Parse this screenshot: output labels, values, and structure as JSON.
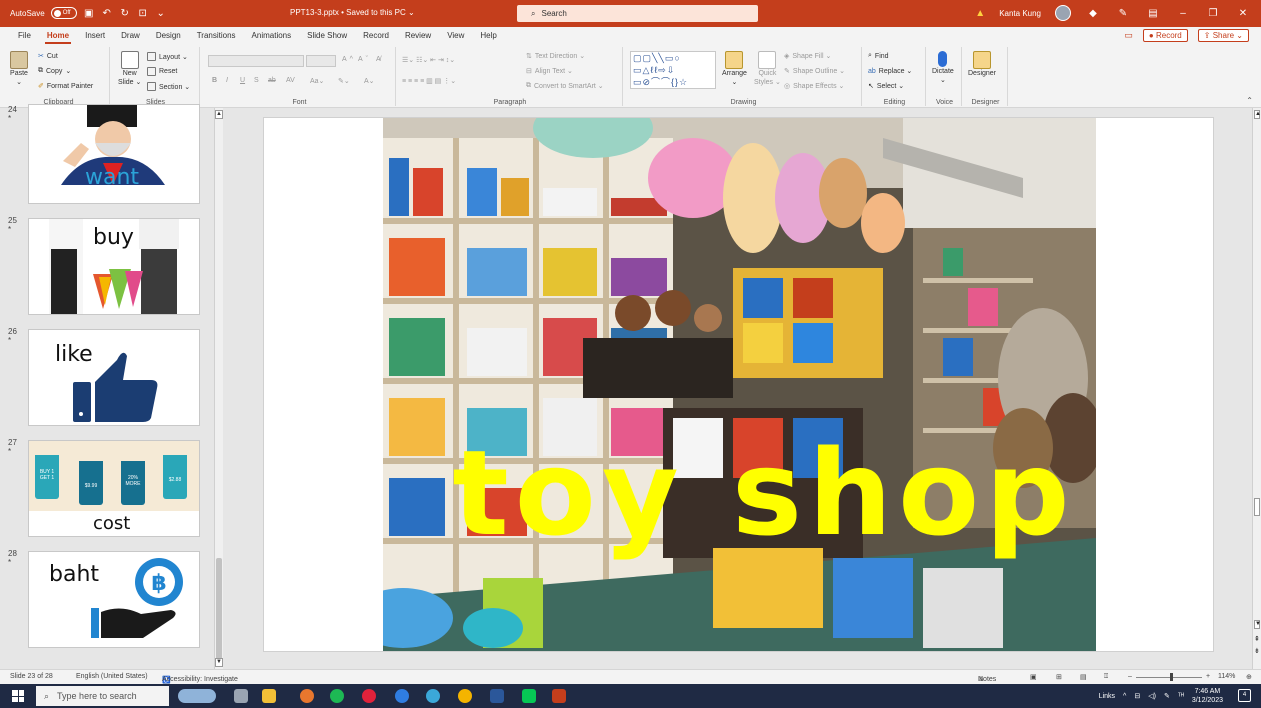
{
  "titlebar": {
    "autosave_label": "AutoSave",
    "autosave_state": "Off",
    "doc_title": "PPT13-3.pptx • Saved to this PC ⌄",
    "search_placeholder": "Search",
    "user_name": "Kanta Kung",
    "accent_color": "#c43e1c"
  },
  "ribbon_tabs": [
    "File",
    "Home",
    "Insert",
    "Draw",
    "Design",
    "Transitions",
    "Animations",
    "Slide Show",
    "Record",
    "Review",
    "View",
    "Help"
  ],
  "active_tab": "Home",
  "ribbon_right": {
    "record": "Record",
    "share": "Share"
  },
  "clipboard": {
    "paste": "Paste",
    "cut": "Cut",
    "copy": "Copy",
    "format_painter": "Format Painter",
    "label": "Clipboard"
  },
  "slides_group": {
    "new_slide_line1": "New",
    "new_slide_line2": "Slide ⌄",
    "layout": "Layout ⌄",
    "reset": "Reset",
    "section": "Section ⌄",
    "label": "Slides"
  },
  "font_group": {
    "label": "Font",
    "grow": "A",
    "shrink": "A",
    "bold": "B",
    "italic": "I",
    "underline": "U",
    "strike": "S",
    "abc": "ab",
    "spacing": "AV",
    "case": "Aa⌄"
  },
  "paragraph_group": {
    "text_direction": "Text Direction ⌄",
    "align_text": "Align Text ⌄",
    "smartart": "Convert to SmartArt ⌄",
    "label": "Paragraph"
  },
  "drawing_group": {
    "arrange": "Arrange",
    "quick_styles_line1": "Quick",
    "quick_styles_line2": "Styles ⌄",
    "shape_fill": "Shape Fill ⌄",
    "shape_outline": "Shape Outline ⌄",
    "shape_effects": "Shape Effects ⌄",
    "label": "Drawing"
  },
  "editing_group": {
    "find": "Find",
    "replace": "Replace ⌄",
    "select": "Select ⌄",
    "label": "Editing"
  },
  "voice_group": {
    "dictate": "Dictate",
    "label": "Voice"
  },
  "designer_group": {
    "designer": "Designer",
    "label": "Designer"
  },
  "thumbnails": [
    {
      "num": "24",
      "star": "*",
      "word": "want"
    },
    {
      "num": "25",
      "star": "*",
      "word": "buy"
    },
    {
      "num": "26",
      "star": "*",
      "word": "like"
    },
    {
      "num": "27",
      "star": "*",
      "word": "cost",
      "tags": [
        "BUY 1 GET 1",
        "$9.99",
        "20% MORE",
        "$2.88"
      ]
    },
    {
      "num": "28",
      "star": "*",
      "word": "baht"
    }
  ],
  "slide": {
    "title": "toy shop",
    "title_color": "#ffff00"
  },
  "statusbar": {
    "slide_info": "Slide 23 of 28",
    "language": "English (United States)",
    "accessibility": "Accessibility: Investigate",
    "notes": "Notes",
    "zoom": "114%"
  },
  "taskbar": {
    "search_placeholder": "Type here to search",
    "links": "Links",
    "time": "7:46 AM",
    "date": "3/12/2023",
    "notifications": "4"
  }
}
